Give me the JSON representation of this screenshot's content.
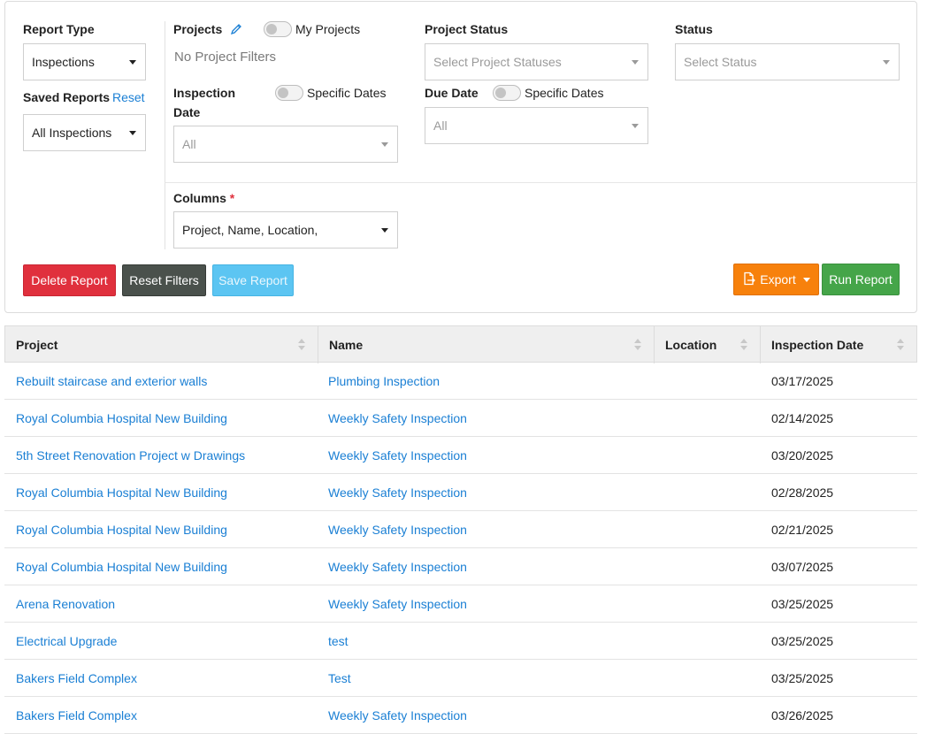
{
  "filters": {
    "report_type": {
      "label": "Report Type",
      "value": "Inspections"
    },
    "saved_reports": {
      "label": "Saved Reports",
      "reset_label": "Reset",
      "value": "All Inspections"
    },
    "projects": {
      "label": "Projects",
      "toggle_label": "My Projects",
      "empty_text": "No Project Filters"
    },
    "inspection_date": {
      "label_line1": "Inspection",
      "label_line2": "Date",
      "toggle_label": "Specific Dates",
      "value": "All"
    },
    "project_status": {
      "label": "Project Status",
      "placeholder": "Select Project Statuses"
    },
    "due_date": {
      "label": "Due Date",
      "toggle_label": "Specific Dates",
      "value": "All"
    },
    "status": {
      "label": "Status",
      "placeholder": "Select Status"
    },
    "columns": {
      "label": "Columns",
      "required_mark": "*",
      "value": "Project, Name, Location,"
    }
  },
  "buttons": {
    "delete": "Delete Report",
    "reset_filters": "Reset Filters",
    "save": "Save Report",
    "export": "Export",
    "run": "Run Report"
  },
  "table": {
    "headers": [
      "Project",
      "Name",
      "Location",
      "Inspection Date"
    ],
    "rows": [
      {
        "project": "Rebuilt staircase and exterior walls",
        "name": "Plumbing Inspection",
        "location": "",
        "date": "03/17/2025"
      },
      {
        "project": "Royal Columbia Hospital New Building",
        "name": "Weekly Safety Inspection",
        "location": "",
        "date": "02/14/2025"
      },
      {
        "project": "5th Street Renovation Project w Drawings",
        "name": "Weekly Safety Inspection",
        "location": "",
        "date": "03/20/2025"
      },
      {
        "project": "Royal Columbia Hospital New Building",
        "name": "Weekly Safety Inspection",
        "location": "",
        "date": "02/28/2025"
      },
      {
        "project": "Royal Columbia Hospital New Building",
        "name": "Weekly Safety Inspection",
        "location": "",
        "date": "02/21/2025"
      },
      {
        "project": "Royal Columbia Hospital New Building",
        "name": "Weekly Safety Inspection",
        "location": "",
        "date": "03/07/2025"
      },
      {
        "project": "Arena Renovation",
        "name": "Weekly Safety Inspection",
        "location": "",
        "date": "03/25/2025"
      },
      {
        "project": "Electrical Upgrade",
        "name": "test",
        "location": "",
        "date": "03/25/2025"
      },
      {
        "project": "Bakers Field Complex",
        "name": "Test",
        "location": "",
        "date": "03/25/2025"
      },
      {
        "project": "Bakers Field Complex",
        "name": "Weekly Safety Inspection",
        "location": "",
        "date": "03/26/2025"
      }
    ]
  },
  "colors": {
    "link": "#1a7fd4",
    "delete": "#e0303d",
    "reset": "#4a514c",
    "save": "#5cc5f2",
    "export": "#f7810c",
    "run": "#45a549"
  }
}
